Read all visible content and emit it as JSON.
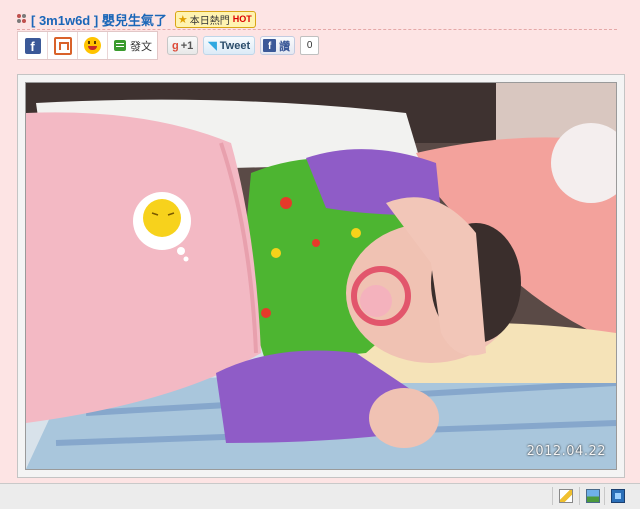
{
  "post": {
    "tag": "[ 3m1w6d ]",
    "title": "嬰兒生氣了",
    "badge_text": "本日熱門",
    "badge_hot": "HOT"
  },
  "share": {
    "facebook_icon": "f",
    "plurk_icon": "plurk-icon",
    "emoticon_icon": "emoticon-icon",
    "post_label": "發文",
    "gplus_g": "g",
    "gplus_label": "+1",
    "tweet_label": "Tweet",
    "fb_like_label": "讚",
    "like_count": "0"
  },
  "photo": {
    "date_stamp": "2012.04.22"
  },
  "status_bar": {
    "icons": [
      "edit-icon",
      "image-icon",
      "film-icon"
    ]
  },
  "colors": {
    "page_bg": "#fde4e4",
    "title_link": "#1a66b8",
    "facebook": "#3b5998"
  }
}
